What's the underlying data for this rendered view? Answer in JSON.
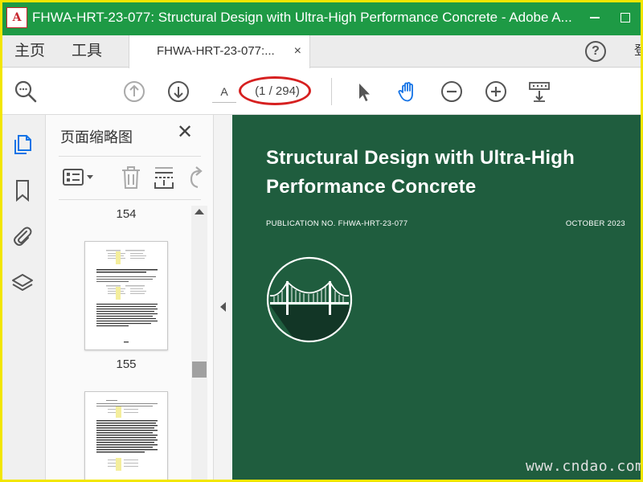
{
  "window": {
    "title": "FHWA-HRT-23-077: Structural Design with Ultra-High Performance Concrete - Adobe A...",
    "logo_char": "A"
  },
  "menu": {
    "home": "主页",
    "tools": "工具"
  },
  "tab": {
    "label": "FHWA-HRT-23-077:...",
    "close": "×"
  },
  "toolbar": {
    "page_field": "A",
    "page_count": "(1 / 294)",
    "help": "?",
    "signin_partial": "登"
  },
  "panel": {
    "title": "页面缩略图",
    "close": "✕",
    "thumbnails": [
      {
        "page_label": "154"
      },
      {
        "page_label": "155"
      }
    ]
  },
  "document": {
    "title": "Structural Design with Ultra-High Performance Concrete",
    "publication": "PUBLICATION NO. FHWA-HRT-23-077",
    "date": "OCTOBER 2023"
  },
  "watermark": "www.cndao.com",
  "colors": {
    "titlebar": "#1e9a45",
    "document_bg": "#1f5d3e",
    "highlight_ellipse": "#d62020",
    "frame": "#f2e600",
    "active_tool": "#1473e6"
  }
}
